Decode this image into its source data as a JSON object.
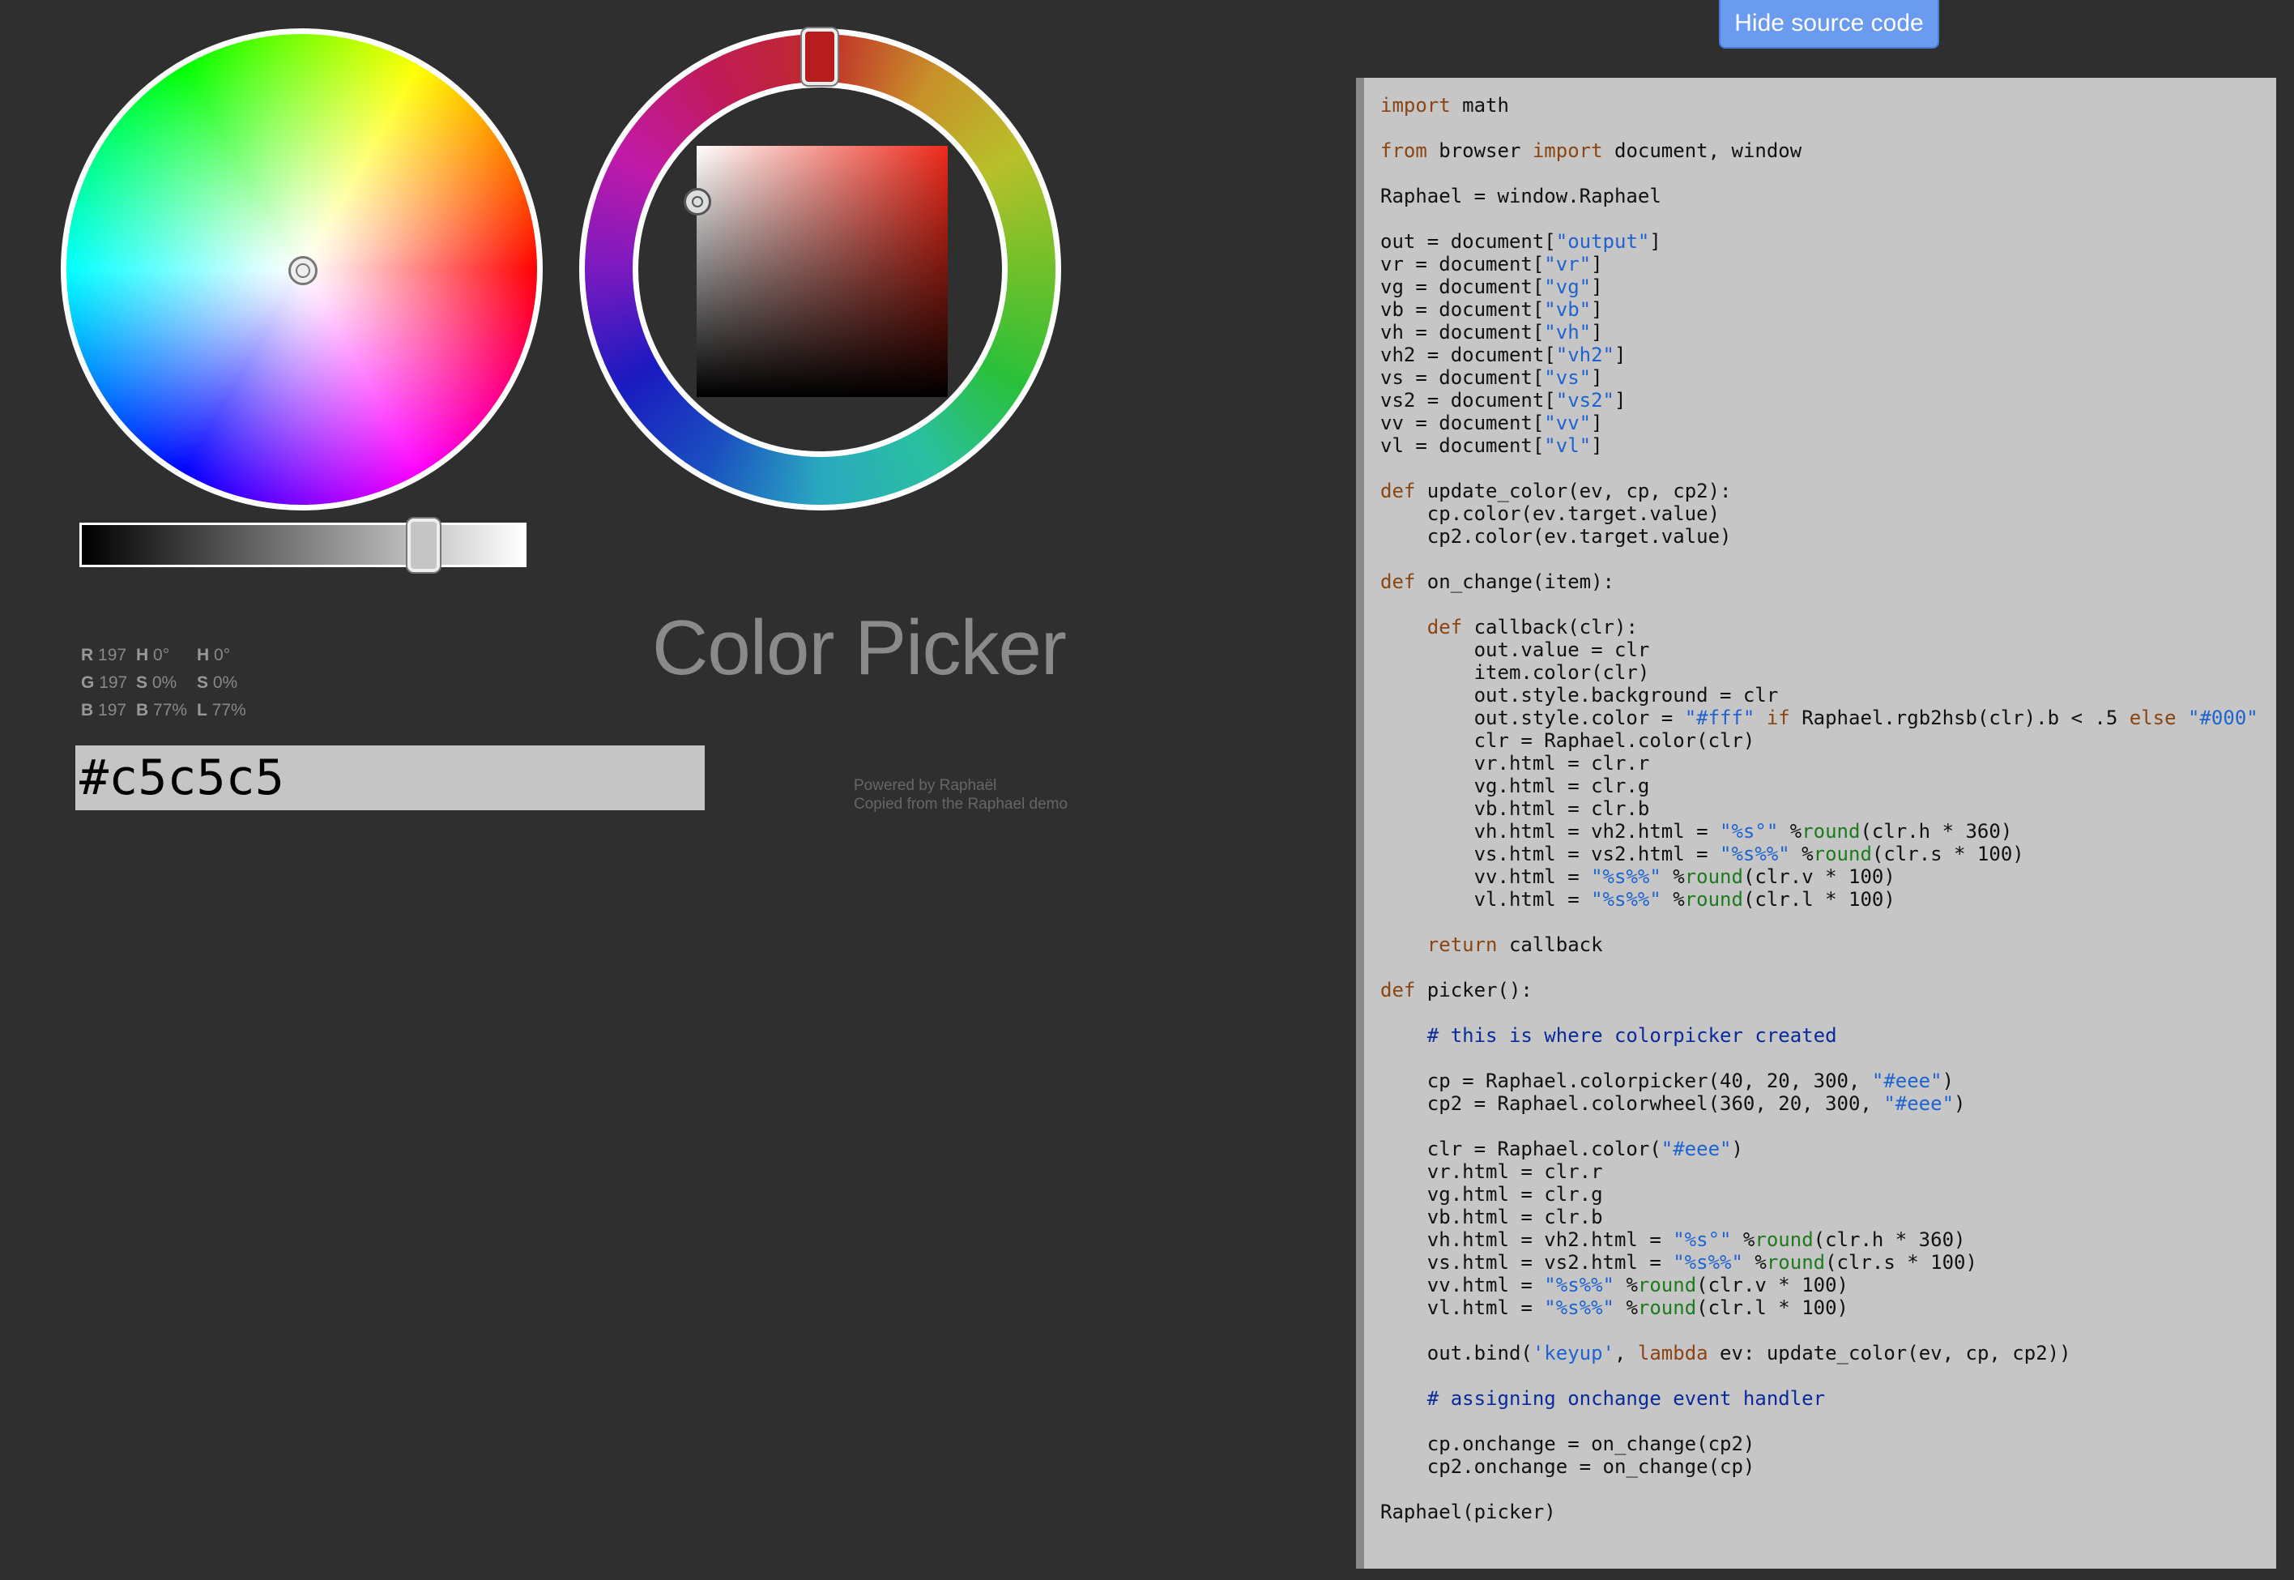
{
  "toolbar": {
    "hide_source_label": "Hide source code"
  },
  "picker": {
    "selected_color": "#c5c5c5",
    "wheel_hue_color": "#b71d1d",
    "brightness_fraction": 0.77
  },
  "readout": {
    "rows": [
      {
        "k1": "R",
        "v1": "197",
        "k2": "H",
        "v2": "0°",
        "k3": "H",
        "v3": "0°"
      },
      {
        "k1": "G",
        "v1": "197",
        "k2": "S",
        "v2": "0%",
        "k3": "S",
        "v3": "0%"
      },
      {
        "k1": "B",
        "v1": "197",
        "k2": "B",
        "v2": "77%",
        "k3": "L",
        "v3": "77%"
      }
    ]
  },
  "title": "Color Picker",
  "output_value": "#c5c5c5",
  "credits": {
    "line1": "Powered by Raphaël",
    "line2": "Copied from the Raphael demo"
  },
  "code_lines": [
    [
      [
        "kw",
        "import"
      ],
      [
        "p",
        " math"
      ]
    ],
    [],
    [
      [
        "kw",
        "from"
      ],
      [
        "p",
        " browser "
      ],
      [
        "kw",
        "import"
      ],
      [
        "p",
        " document, window"
      ]
    ],
    [],
    [
      [
        "p",
        "Raphael = window.Raphael"
      ]
    ],
    [],
    [
      [
        "p",
        "out = document["
      ],
      [
        "st",
        "\"output\""
      ],
      [
        "p",
        "]"
      ]
    ],
    [
      [
        "p",
        "vr = document["
      ],
      [
        "st",
        "\"vr\""
      ],
      [
        "p",
        "]"
      ]
    ],
    [
      [
        "p",
        "vg = document["
      ],
      [
        "st",
        "\"vg\""
      ],
      [
        "p",
        "]"
      ]
    ],
    [
      [
        "p",
        "vb = document["
      ],
      [
        "st",
        "\"vb\""
      ],
      [
        "p",
        "]"
      ]
    ],
    [
      [
        "p",
        "vh = document["
      ],
      [
        "st",
        "\"vh\""
      ],
      [
        "p",
        "]"
      ]
    ],
    [
      [
        "p",
        "vh2 = document["
      ],
      [
        "st",
        "\"vh2\""
      ],
      [
        "p",
        "]"
      ]
    ],
    [
      [
        "p",
        "vs = document["
      ],
      [
        "st",
        "\"vs\""
      ],
      [
        "p",
        "]"
      ]
    ],
    [
      [
        "p",
        "vs2 = document["
      ],
      [
        "st",
        "\"vs2\""
      ],
      [
        "p",
        "]"
      ]
    ],
    [
      [
        "p",
        "vv = document["
      ],
      [
        "st",
        "\"vv\""
      ],
      [
        "p",
        "]"
      ]
    ],
    [
      [
        "p",
        "vl = document["
      ],
      [
        "st",
        "\"vl\""
      ],
      [
        "p",
        "]"
      ]
    ],
    [],
    [
      [
        "kw",
        "def"
      ],
      [
        "p",
        " update_color(ev, cp, cp2):"
      ]
    ],
    [
      [
        "p",
        "    cp.color(ev.target.value)"
      ]
    ],
    [
      [
        "p",
        "    cp2.color(ev.target.value)"
      ]
    ],
    [],
    [
      [
        "kw",
        "def"
      ],
      [
        "p",
        " on_change(item):"
      ]
    ],
    [],
    [
      [
        "p",
        "    "
      ],
      [
        "kw",
        "def"
      ],
      [
        "p",
        " callback(clr):"
      ]
    ],
    [
      [
        "p",
        "        out.value = clr"
      ]
    ],
    [
      [
        "p",
        "        item.color(clr)"
      ]
    ],
    [
      [
        "p",
        "        out.style.background = clr"
      ]
    ],
    [
      [
        "p",
        "        out.style.color = "
      ],
      [
        "st",
        "\"#fff\""
      ],
      [
        "p",
        " "
      ],
      [
        "kw",
        "if"
      ],
      [
        "p",
        " Raphael.rgb2hsb(clr).b < .5 "
      ],
      [
        "kw",
        "else"
      ],
      [
        "p",
        " "
      ],
      [
        "st",
        "\"#000\""
      ]
    ],
    [
      [
        "p",
        "        clr = Raphael.color(clr)"
      ]
    ],
    [
      [
        "p",
        "        vr.html = clr.r"
      ]
    ],
    [
      [
        "p",
        "        vg.html = clr.g"
      ]
    ],
    [
      [
        "p",
        "        vb.html = clr.b"
      ]
    ],
    [
      [
        "p",
        "        vh.html = vh2.html = "
      ],
      [
        "st",
        "\"%s°\""
      ],
      [
        "p",
        " %"
      ],
      [
        "bi",
        "round"
      ],
      [
        "p",
        "(clr.h * 360)"
      ]
    ],
    [
      [
        "p",
        "        vs.html = vs2.html = "
      ],
      [
        "st",
        "\"%s%%\""
      ],
      [
        "p",
        " %"
      ],
      [
        "bi",
        "round"
      ],
      [
        "p",
        "(clr.s * 100)"
      ]
    ],
    [
      [
        "p",
        "        vv.html = "
      ],
      [
        "st",
        "\"%s%%\""
      ],
      [
        "p",
        " %"
      ],
      [
        "bi",
        "round"
      ],
      [
        "p",
        "(clr.v * 100)"
      ]
    ],
    [
      [
        "p",
        "        vl.html = "
      ],
      [
        "st",
        "\"%s%%\""
      ],
      [
        "p",
        " %"
      ],
      [
        "bi",
        "round"
      ],
      [
        "p",
        "(clr.l * 100)"
      ]
    ],
    [],
    [
      [
        "p",
        "    "
      ],
      [
        "kw",
        "return"
      ],
      [
        "p",
        " callback"
      ]
    ],
    [],
    [
      [
        "kw",
        "def"
      ],
      [
        "p",
        " picker():"
      ]
    ],
    [],
    [
      [
        "p",
        "    "
      ],
      [
        "cm",
        "# this is where colorpicker created"
      ]
    ],
    [],
    [
      [
        "p",
        "    cp = Raphael.colorpicker(40, 20, 300, "
      ],
      [
        "st",
        "\"#eee\""
      ],
      [
        "p",
        ")"
      ]
    ],
    [
      [
        "p",
        "    cp2 = Raphael.colorwheel(360, 20, 300, "
      ],
      [
        "st",
        "\"#eee\""
      ],
      [
        "p",
        ")"
      ]
    ],
    [],
    [
      [
        "p",
        "    clr = Raphael.color("
      ],
      [
        "st",
        "\"#eee\""
      ],
      [
        "p",
        ")"
      ]
    ],
    [
      [
        "p",
        "    vr.html = clr.r"
      ]
    ],
    [
      [
        "p",
        "    vg.html = clr.g"
      ]
    ],
    [
      [
        "p",
        "    vb.html = clr.b"
      ]
    ],
    [
      [
        "p",
        "    vh.html = vh2.html = "
      ],
      [
        "st",
        "\"%s°\""
      ],
      [
        "p",
        " %"
      ],
      [
        "bi",
        "round"
      ],
      [
        "p",
        "(clr.h * 360)"
      ]
    ],
    [
      [
        "p",
        "    vs.html = vs2.html = "
      ],
      [
        "st",
        "\"%s%%\""
      ],
      [
        "p",
        " %"
      ],
      [
        "bi",
        "round"
      ],
      [
        "p",
        "(clr.s * 100)"
      ]
    ],
    [
      [
        "p",
        "    vv.html = "
      ],
      [
        "st",
        "\"%s%%\""
      ],
      [
        "p",
        " %"
      ],
      [
        "bi",
        "round"
      ],
      [
        "p",
        "(clr.v * 100)"
      ]
    ],
    [
      [
        "p",
        "    vl.html = "
      ],
      [
        "st",
        "\"%s%%\""
      ],
      [
        "p",
        " %"
      ],
      [
        "bi",
        "round"
      ],
      [
        "p",
        "(clr.l * 100)"
      ]
    ],
    [],
    [
      [
        "p",
        "    out.bind("
      ],
      [
        "st",
        "'keyup'"
      ],
      [
        "p",
        ", "
      ],
      [
        "kw",
        "lambda"
      ],
      [
        "p",
        " ev: update_color(ev, cp, cp2))"
      ]
    ],
    [],
    [
      [
        "p",
        "    "
      ],
      [
        "cm",
        "# assigning onchange event handler"
      ]
    ],
    [],
    [
      [
        "p",
        "    cp.onchange = on_change(cp2)"
      ]
    ],
    [
      [
        "p",
        "    cp2.onchange = on_change(cp)"
      ]
    ],
    [],
    [
      [
        "p",
        "Raphael(picker)"
      ]
    ]
  ]
}
